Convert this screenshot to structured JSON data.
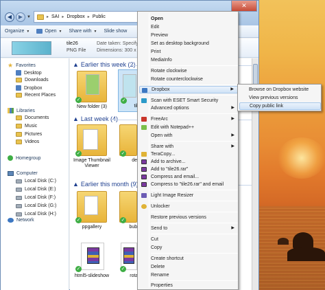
{
  "window": {
    "breadcrumb": [
      "SAI",
      "Dropbox",
      "Public"
    ],
    "back_glyph": "◀",
    "forward_glyph": "▶",
    "close_glyph": "✕"
  },
  "toolbar": {
    "organize": "Organize",
    "open": "Open",
    "share_with": "Share with",
    "slideshow": "Slide show"
  },
  "details": {
    "file_name": "tile26",
    "file_type": "PNG File",
    "date_taken": "Date taken: Specify date",
    "dimensions": "Dimensions: 300 x 100"
  },
  "sidebar": {
    "favorites": "Favorites",
    "favorite_items": [
      "Desktop",
      "Downloads",
      "Dropbox",
      "Recent Places"
    ],
    "libraries": "Libraries",
    "library_items": [
      "Documents",
      "Music",
      "Pictures",
      "Videos"
    ],
    "homegroup": "Homegroup",
    "computer": "Computer",
    "drives": [
      "Local Disk (C:)",
      "Local Disk (E:)",
      "Local Disk (F:)",
      "Local Disk (G:)",
      "Local Disk (H:)"
    ],
    "network": "Network"
  },
  "groups": {
    "earlier_week": "Earlier this week (2)",
    "last_week": "Last week (4)",
    "earlier_month": "Earlier this month (9)"
  },
  "files": {
    "new_folder": "New folder (3)",
    "tile_partial": "til",
    "image_viewer": "Image Thumbnail Viewer",
    "dem_partial": "dem",
    "ppgallery": "ppgallery",
    "bubble_partial": "bubble",
    "html5_slideshow": "html5-slideshow",
    "rotating_partial": "rotatin"
  },
  "context_menu": {
    "items": {
      "open": "Open",
      "edit": "Edit",
      "preview": "Preview",
      "set_background": "Set as desktop background",
      "print": "Print",
      "mediainfo": "MediaInfo",
      "rotate_cw": "Rotate clockwise",
      "rotate_ccw": "Rotate counterclockwise",
      "dropbox": "Dropbox",
      "eset": "Scan with ESET Smart Security",
      "advanced": "Advanced options",
      "freearc": "FreeArc",
      "notepad": "Edit with Notepad++",
      "open_with": "Open with",
      "share_with": "Share with",
      "teracopy": "TeraCopy...",
      "add_archive": "Add to archive...",
      "add_rar": "Add to \"tile26.rar\"",
      "compress_email": "Compress and email...",
      "compress_rar_email": "Compress to \"tile26.rar\" and email",
      "resizer": "Light Image Resizer",
      "unlocker": "Unlocker",
      "restore": "Restore previous versions",
      "send_to": "Send to",
      "cut": "Cut",
      "copy": "Copy",
      "create_shortcut": "Create shortcut",
      "delete": "Delete",
      "rename": "Rename",
      "properties": "Properties"
    },
    "submenu_arrow": "▶"
  },
  "dropbox_submenu": {
    "browse": "Browse on Dropbox website",
    "versions": "View previous versions",
    "copy_link": "Copy public link"
  },
  "colors": {
    "menu_highlight": "#cfe2f6",
    "group_title": "#1e3f8f",
    "check_green": "#3fae45"
  }
}
